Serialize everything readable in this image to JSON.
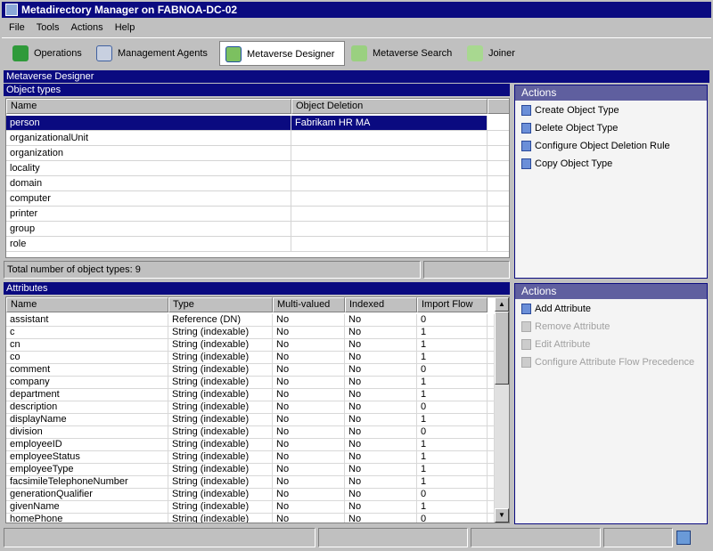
{
  "window": {
    "title": "Metadirectory Manager on FABNOA-DC-02"
  },
  "menu": [
    "File",
    "Tools",
    "Actions",
    "Help"
  ],
  "toolbar": [
    {
      "label": "Operations",
      "icon": "operations-icon",
      "active": false
    },
    {
      "label": "Management Agents",
      "icon": "management-agents-icon",
      "active": false
    },
    {
      "label": "Metaverse Designer",
      "icon": "metaverse-designer-icon",
      "active": true
    },
    {
      "label": "Metaverse Search",
      "icon": "metaverse-search-icon",
      "active": false
    },
    {
      "label": "Joiner",
      "icon": "joiner-icon",
      "active": false
    }
  ],
  "section_title": "Metaverse Designer",
  "object_types": {
    "title": "Object types",
    "columns": [
      "Name",
      "Object Deletion"
    ],
    "rows": [
      [
        "person",
        "Fabrikam HR MA"
      ],
      [
        "organizationalUnit",
        ""
      ],
      [
        "organization",
        ""
      ],
      [
        "locality",
        ""
      ],
      [
        "domain",
        ""
      ],
      [
        "computer",
        ""
      ],
      [
        "printer",
        ""
      ],
      [
        "group",
        ""
      ],
      [
        "role",
        ""
      ]
    ],
    "selected": 0,
    "footer": "Total number of object types: 9"
  },
  "object_actions": {
    "title": "Actions",
    "items": [
      {
        "label": "Create Object Type",
        "enabled": true
      },
      {
        "label": "Delete Object Type",
        "enabled": true
      },
      {
        "label": "Configure Object Deletion Rule",
        "enabled": true
      },
      {
        "label": "Copy Object Type",
        "enabled": true
      }
    ]
  },
  "attributes": {
    "title": "Attributes",
    "columns": [
      "Name",
      "Type",
      "Multi-valued",
      "Indexed",
      "Import Flow"
    ],
    "rows": [
      [
        "assistant",
        "Reference (DN)",
        "No",
        "No",
        "0"
      ],
      [
        "c",
        "String (indexable)",
        "No",
        "No",
        "1"
      ],
      [
        "cn",
        "String (indexable)",
        "No",
        "No",
        "1"
      ],
      [
        "co",
        "String (indexable)",
        "No",
        "No",
        "1"
      ],
      [
        "comment",
        "String (indexable)",
        "No",
        "No",
        "0"
      ],
      [
        "company",
        "String (indexable)",
        "No",
        "No",
        "1"
      ],
      [
        "department",
        "String (indexable)",
        "No",
        "No",
        "1"
      ],
      [
        "description",
        "String (indexable)",
        "No",
        "No",
        "0"
      ],
      [
        "displayName",
        "String (indexable)",
        "No",
        "No",
        "1"
      ],
      [
        "division",
        "String (indexable)",
        "No",
        "No",
        "0"
      ],
      [
        "employeeID",
        "String (indexable)",
        "No",
        "No",
        "1"
      ],
      [
        "employeeStatus",
        "String (indexable)",
        "No",
        "No",
        "1"
      ],
      [
        "employeeType",
        "String (indexable)",
        "No",
        "No",
        "1"
      ],
      [
        "facsimileTelephoneNumber",
        "String (indexable)",
        "No",
        "No",
        "1"
      ],
      [
        "generationQualifier",
        "String (indexable)",
        "No",
        "No",
        "0"
      ],
      [
        "givenName",
        "String (indexable)",
        "No",
        "No",
        "1"
      ],
      [
        "homePhone",
        "String (indexable)",
        "No",
        "No",
        "0"
      ]
    ]
  },
  "attribute_actions": {
    "title": "Actions",
    "items": [
      {
        "label": "Add Attribute",
        "enabled": true
      },
      {
        "label": "Remove Attribute",
        "enabled": false
      },
      {
        "label": "Edit Attribute",
        "enabled": false
      },
      {
        "label": "Configure Attribute Flow Precedence",
        "enabled": false
      }
    ]
  },
  "colors": {
    "titlebar": "#0a0a80",
    "actions_header": "#5f5f9f",
    "selection": "#0a0a80"
  }
}
